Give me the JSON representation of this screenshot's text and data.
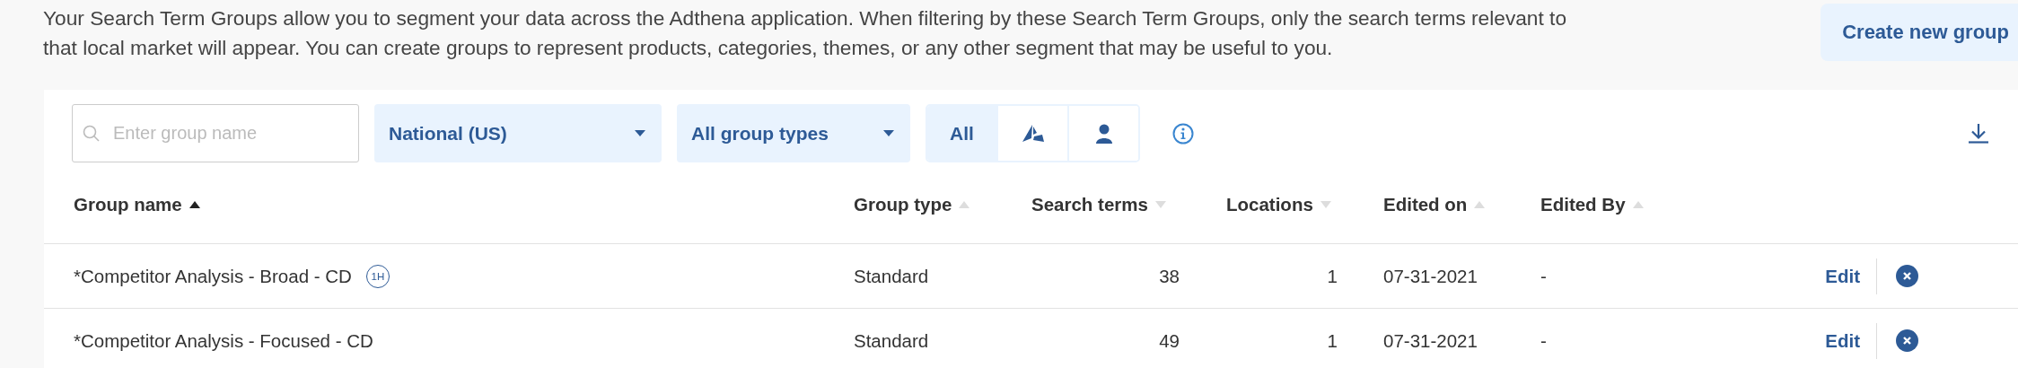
{
  "intro": "Your Search Term Groups allow you to segment your data across the Adthena application. When filtering by these Search Term Groups, only the search terms relevant to that local market will appear. You can create groups to represent products, categories, themes, or any other segment that may be useful to you.",
  "create_button": "Create new group",
  "filters": {
    "search": {
      "placeholder": "Enter group name"
    },
    "dropdowns": [
      {
        "value": "National (US)"
      },
      {
        "value": "All group types"
      }
    ],
    "segments": [
      {
        "kind": "text",
        "label": "All",
        "selected": true
      },
      {
        "kind": "triangle",
        "selected": false
      },
      {
        "kind": "person",
        "selected": false
      }
    ]
  },
  "table": {
    "columns": [
      {
        "label": "Group name",
        "descending": false,
        "active": true
      },
      {
        "label": "Group type",
        "descending": false,
        "active": false
      },
      {
        "label": "Search terms",
        "descending": true,
        "active": false
      },
      {
        "label": "Locations",
        "descending": true,
        "active": false
      },
      {
        "label": "Edited on",
        "descending": false,
        "active": false
      },
      {
        "label": "Edited By",
        "descending": false,
        "active": false
      }
    ],
    "rows": [
      {
        "name": "*Competitor Analysis - Broad - CD",
        "badge": "1H",
        "type": "Standard",
        "search_terms": "38",
        "locations": "1",
        "edited_on": "07-31-2021",
        "edited_by": "-",
        "action": "Edit"
      },
      {
        "name": "*Competitor Analysis - Focused - CD",
        "type": "Standard",
        "search_terms": "49",
        "locations": "1",
        "edited_on": "07-31-2021",
        "edited_by": "-",
        "action": "Edit"
      }
    ]
  }
}
